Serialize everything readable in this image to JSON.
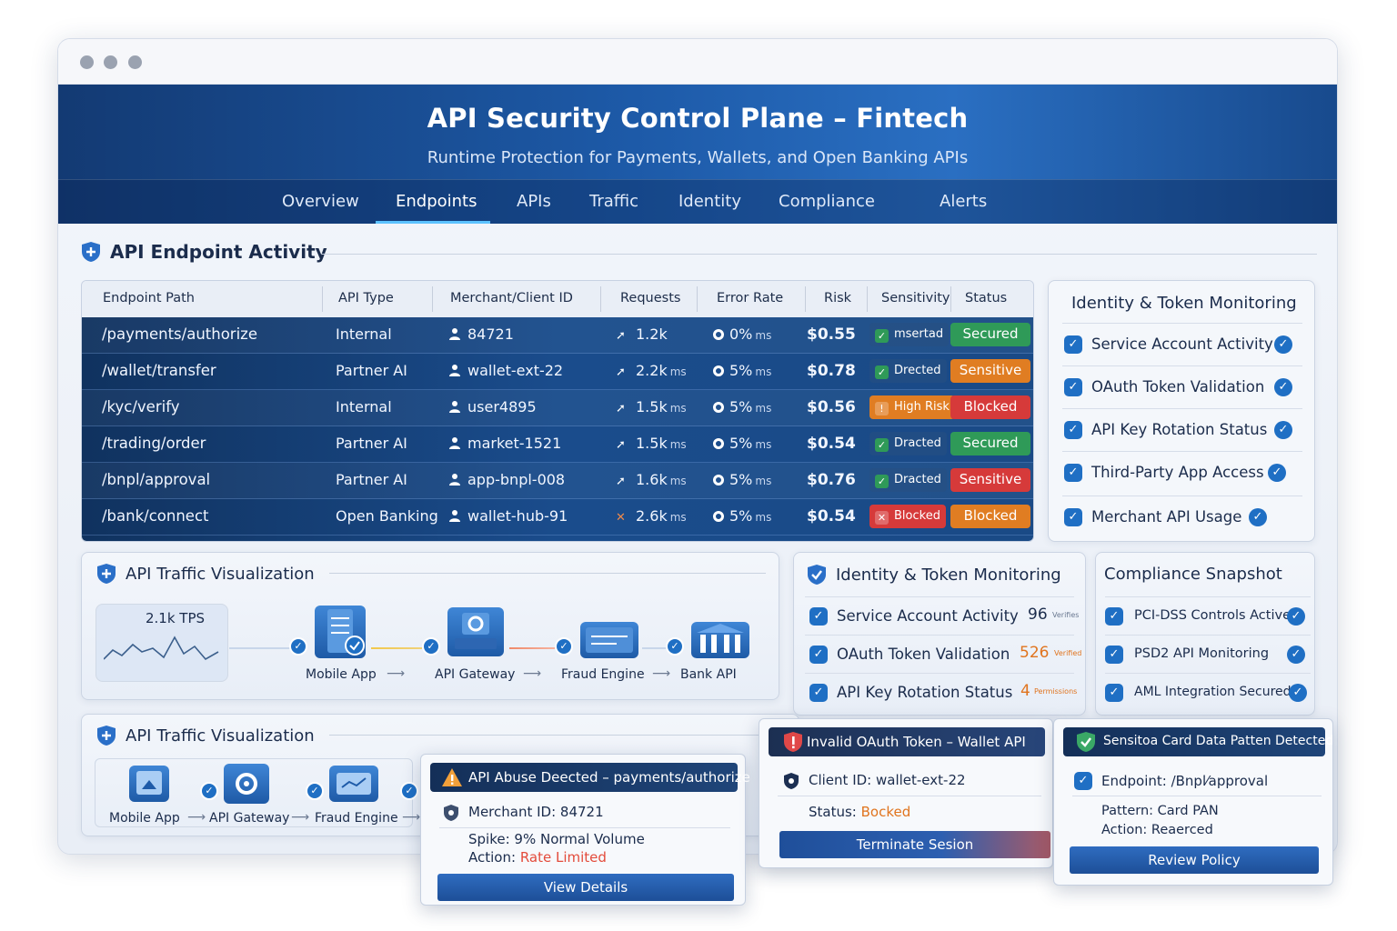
{
  "header": {
    "title": "API Security Control Plane – Fintech",
    "subtitle": "Runtime Protection for Payments, Wallets, and Open Banking APIs"
  },
  "nav": {
    "tabs": [
      "Overview",
      "Endpoints",
      "APIs",
      "Traffic",
      "Identity",
      "Compliance",
      "Alerts"
    ],
    "active": "Endpoints"
  },
  "endpoint_section": {
    "title": "API Endpoint Activity"
  },
  "table": {
    "columns": [
      "Endpoint Path",
      "API Type",
      "Merchant/Client ID",
      "Requests",
      "Error Rate",
      "Risk",
      "Sensitivity",
      "Status"
    ],
    "rows": [
      {
        "path": "/payments/authorize",
        "type": "Internal",
        "client": "84721",
        "requests": "1.2k",
        "req_unit": "",
        "error": "0%",
        "err_unit": "ms",
        "risk": "$0.55",
        "sensitivity": "msertad",
        "sens_color": "green",
        "status": "Secured",
        "status_color": "green"
      },
      {
        "path": "/wallet/transfer",
        "type": "Partner AI",
        "client": "wallet-ext-22",
        "requests": "2.2k",
        "req_unit": "ms",
        "error": "5%",
        "err_unit": "ms",
        "risk": "$0.78",
        "sensitivity": "Drected",
        "sens_color": "green",
        "status": "Sensitive",
        "status_color": "orange"
      },
      {
        "path": "/kyc/verify",
        "type": "Internal",
        "client": "user4895",
        "requests": "1.5k",
        "req_unit": "ms",
        "error": "5%",
        "err_unit": "ms",
        "risk": "$0.56",
        "sensitivity": "High Risk",
        "sens_color": "orange",
        "status": "Blocked",
        "status_color": "red"
      },
      {
        "path": "/trading/order",
        "type": "Partner AI",
        "client": "market-1521",
        "requests": "1.5k",
        "req_unit": "ms",
        "error": "5%",
        "err_unit": "ms",
        "risk": "$0.54",
        "sensitivity": "Dracted",
        "sens_color": "green",
        "status": "Secured",
        "status_color": "green"
      },
      {
        "path": "/bnpl/approval",
        "type": "Partner AI",
        "client": "app-bnpl-008",
        "requests": "1.6k",
        "req_unit": "ms",
        "error": "5%",
        "err_unit": "ms",
        "risk": "$0.76",
        "sensitivity": "Dracted",
        "sens_color": "green",
        "status": "Sensitive",
        "status_color": "red"
      },
      {
        "path": "/bank/connect",
        "type": "Open Banking",
        "client": "wallet-hub-91",
        "requests": "2.6k",
        "req_unit": "ms",
        "error": "5%",
        "err_unit": "ms",
        "risk": "$0.54",
        "sensitivity": "Blocked",
        "sens_color": "red",
        "status": "Blocked",
        "status_color": "orange"
      }
    ]
  },
  "identity_panel": {
    "title": "Identity & Token Monitoring",
    "items": [
      "Service Account Activity",
      "OAuth Token Validation",
      "API Key Rotation Status",
      "Third-Party App Access",
      "Merchant API Usage"
    ]
  },
  "traffic_viz": {
    "title": "API Traffic Visualization",
    "tps": "2.1k TPS",
    "nodes": [
      "Mobile App",
      "API Gateway",
      "Fraud Engine",
      "Bank API"
    ]
  },
  "identity_card": {
    "title": "Identity & Token Monitoring",
    "rows": [
      {
        "label": "Service Account Activity",
        "value": "96",
        "note": "Verifies",
        "value_color": "#1b2c4c"
      },
      {
        "label": "OAuth Token Validation",
        "value": "526",
        "note": "Verified",
        "value_color": "#e0741e"
      },
      {
        "label": "API Key Rotation Status",
        "value": "4",
        "note": "Permissions",
        "value_color": "#e0741e"
      }
    ]
  },
  "compliance": {
    "title": "Compliance Snapshot",
    "items": [
      "PCI-DSS Controls Active",
      "PSD2 API Monitoring",
      "AML Integration Secured"
    ]
  },
  "traffic_viz2": {
    "title": "API Traffic Visualization",
    "nodes": [
      "Mobile App",
      "API Gateway",
      "Fraud Engine"
    ]
  },
  "alert_abuse": {
    "title": "API Abuse Deected – payments/authorize",
    "merchant": "Merchant ID: 84721",
    "spike": "Spike: 9% Normal Volume",
    "action_label": "Action: ",
    "action_value": "Rate Limited",
    "button": "View Details"
  },
  "alert_oauth": {
    "title": "Invalid OAuth Token – Wallet API",
    "client": "Client ID: wallet-ext-22",
    "status_label": "Status: ",
    "status_value": "Bocked",
    "button": "Terminate Sesion"
  },
  "alert_card": {
    "title": "Sensitoa Card Data Patten Detected",
    "endpoint": "Endpoint: /Bnpl⁄approval",
    "pattern": "Pattern: Card PAN",
    "action": "Action: Reaerced",
    "button": "Review Policy"
  },
  "colors": {
    "brand": "#1d5aa8",
    "accent": "#5cc2ff",
    "green": "#2f9a58",
    "orange": "#e07d22",
    "red": "#d63a3a"
  }
}
